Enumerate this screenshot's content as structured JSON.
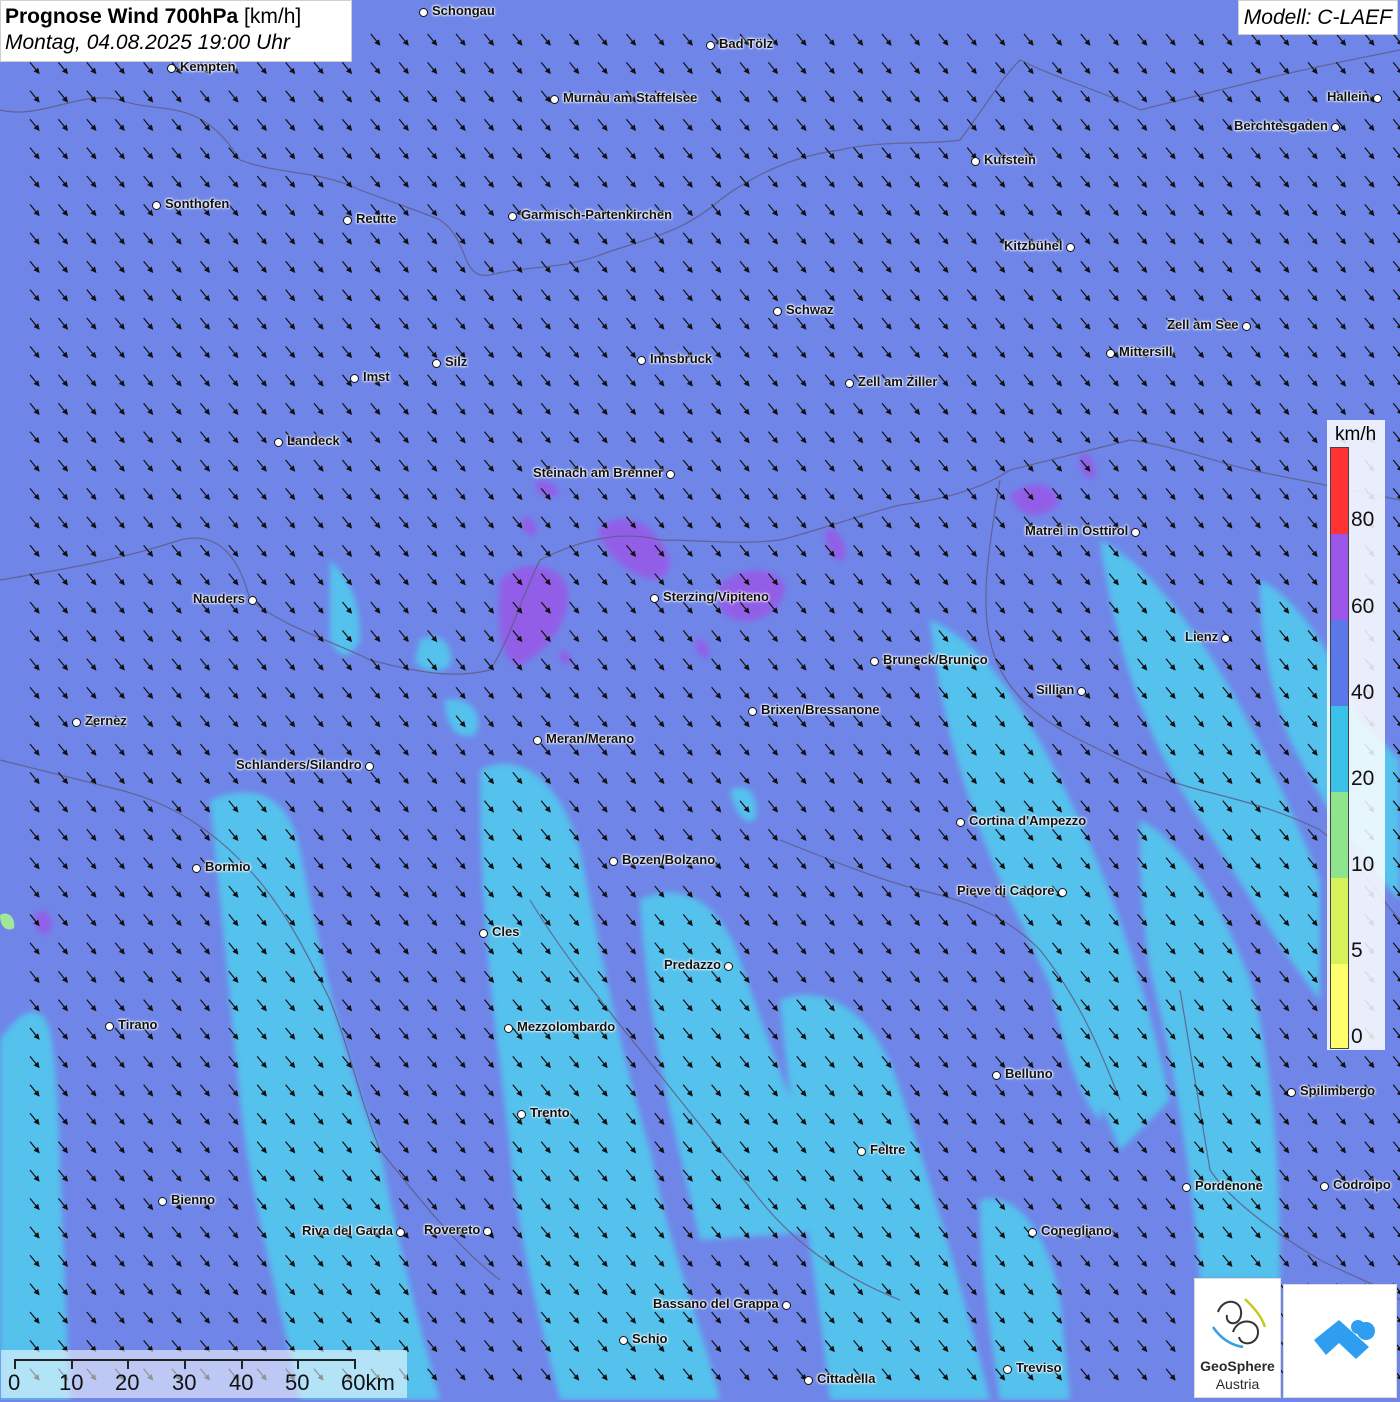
{
  "title": {
    "main": "Prognose Wind 700hPa",
    "unit": "[km/h]",
    "datetime": "Montag, 04.08.2025 19:00 Uhr"
  },
  "model_label": "Modell: C-LAEF",
  "legend": {
    "unit": "km/h",
    "ticks": [
      "80",
      "60",
      "40",
      "20",
      "10",
      "5",
      "0"
    ],
    "colors": [
      "#ff3333",
      "#9b55e8",
      "#5a78e8",
      "#3cc2e8",
      "#8fe58c",
      "#d6f25a",
      "#ffff6b"
    ]
  },
  "scale_bar": {
    "labels": [
      "0",
      "10",
      "20",
      "30",
      "40",
      "50",
      "60km"
    ]
  },
  "logo": {
    "name_line1": "GeoSphere",
    "name_line2": "Austria"
  },
  "wind": {
    "direction": "NW to SE",
    "dominant_speed_band": "40-60 km/h"
  },
  "cities": [
    {
      "name": "Schongau",
      "label_side": "right"
    },
    {
      "name": "Bad Tölz",
      "label_side": "right"
    },
    {
      "name": "Kempten",
      "label_side": "right"
    },
    {
      "name": "Murnau am Staffelsee",
      "label_side": "right"
    },
    {
      "name": "Hallein",
      "label_side": "left"
    },
    {
      "name": "Berchtesgaden",
      "label_side": "left"
    },
    {
      "name": "Kufstein",
      "label_side": "right"
    },
    {
      "name": "Sonthofen",
      "label_side": "right"
    },
    {
      "name": "Reutte",
      "label_side": "right"
    },
    {
      "name": "Garmisch-Partenkirchen",
      "label_side": "right"
    },
    {
      "name": "Kitzbühel",
      "label_side": "left"
    },
    {
      "name": "Schwaz",
      "label_side": "right"
    },
    {
      "name": "Zell am See",
      "label_side": "left"
    },
    {
      "name": "Mittersill",
      "label_side": "right"
    },
    {
      "name": "Silz",
      "label_side": "right"
    },
    {
      "name": "Innsbruck",
      "label_side": "right"
    },
    {
      "name": "Imst",
      "label_side": "right"
    },
    {
      "name": "Zell am Ziller",
      "label_side": "right"
    },
    {
      "name": "Landeck",
      "label_side": "right"
    },
    {
      "name": "Steinach am Brenner",
      "label_side": "left"
    },
    {
      "name": "Matrei in Osttirol",
      "label_side": "left"
    },
    {
      "name": "Nauders",
      "label_side": "left"
    },
    {
      "name": "Sterzing/Vipiteno",
      "label_side": "right"
    },
    {
      "name": "Lienz",
      "label_side": "left"
    },
    {
      "name": "Bruneck/Brunico",
      "label_side": "right"
    },
    {
      "name": "Sillian",
      "label_side": "left"
    },
    {
      "name": "Zernez",
      "label_side": "right"
    },
    {
      "name": "Brixen/Bressanone",
      "label_side": "right"
    },
    {
      "name": "Meran/Merano",
      "label_side": "right"
    },
    {
      "name": "Schlanders/Silandro",
      "label_side": "left"
    },
    {
      "name": "Cortina d'Ampezzo",
      "label_side": "right"
    },
    {
      "name": "Bozen/Bolzano",
      "label_side": "right"
    },
    {
      "name": "Bormio",
      "label_side": "right"
    },
    {
      "name": "Pieve di Cadore",
      "label_side": "left"
    },
    {
      "name": "Cles",
      "label_side": "right"
    },
    {
      "name": "Predazzo",
      "label_side": "left"
    },
    {
      "name": "Tirano",
      "label_side": "right"
    },
    {
      "name": "Mezzolombardo",
      "label_side": "right"
    },
    {
      "name": "Belluno",
      "label_side": "right"
    },
    {
      "name": "Spilimbergo",
      "label_side": "right"
    },
    {
      "name": "Trento",
      "label_side": "right"
    },
    {
      "name": "Feltre",
      "label_side": "right"
    },
    {
      "name": "Pordenone",
      "label_side": "right"
    },
    {
      "name": "Codroipo",
      "label_side": "right"
    },
    {
      "name": "Bienno",
      "label_side": "right"
    },
    {
      "name": "Riva del Garda",
      "label_side": "left"
    },
    {
      "name": "Rovereto",
      "label_side": "left"
    },
    {
      "name": "Conegliano",
      "label_side": "right"
    },
    {
      "name": "Bassano del Grappa",
      "label_side": "left"
    },
    {
      "name": "Schio",
      "label_side": "right"
    },
    {
      "name": "Treviso",
      "label_side": "right"
    },
    {
      "name": "Cittadella",
      "label_side": "right"
    }
  ]
}
